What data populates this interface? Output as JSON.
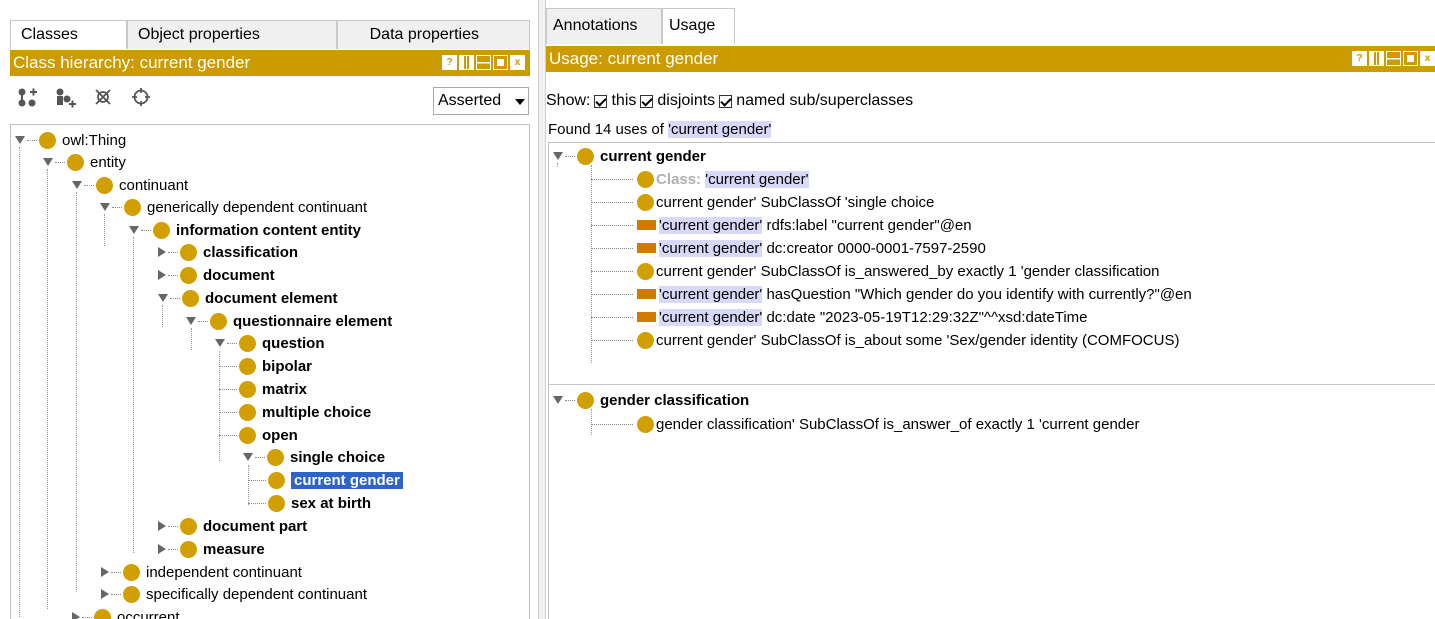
{
  "left": {
    "tabs": [
      "Classes",
      "Object properties",
      "Data properties"
    ],
    "view_title": "Class hierarchy: current gender",
    "view_buttons": [
      "?",
      "",
      "",
      "",
      "x"
    ],
    "tool_icons": [
      "add-subclass-icon",
      "add-sibling-icon",
      "delete-class-icon",
      "target-icon"
    ],
    "select_value": "Asserted",
    "tree": [
      {
        "label": "owl:Thing",
        "bold": false,
        "state": "open"
      },
      {
        "label": "entity",
        "bold": false,
        "state": "open"
      },
      {
        "label": "continuant",
        "bold": false,
        "state": "open"
      },
      {
        "label": "generically dependent continuant",
        "bold": false,
        "state": "open"
      },
      {
        "label": "information content entity",
        "bold": true,
        "state": "open"
      },
      {
        "label": "classification",
        "bold": true,
        "state": "closed"
      },
      {
        "label": "document",
        "bold": true,
        "state": "closed"
      },
      {
        "label": "document element",
        "bold": true,
        "state": "open"
      },
      {
        "label": "questionnaire element",
        "bold": true,
        "state": "open"
      },
      {
        "label": "question",
        "bold": true,
        "state": "open"
      },
      {
        "label": "bipolar",
        "bold": true,
        "state": "leaf"
      },
      {
        "label": "matrix",
        "bold": true,
        "state": "leaf"
      },
      {
        "label": "multiple choice",
        "bold": true,
        "state": "leaf"
      },
      {
        "label": "open",
        "bold": true,
        "state": "leaf"
      },
      {
        "label": "single choice",
        "bold": true,
        "state": "open"
      },
      {
        "label": "current gender",
        "bold": true,
        "state": "leaf",
        "selected": true
      },
      {
        "label": "sex at birth",
        "bold": true,
        "state": "leaf"
      },
      {
        "label": "document part",
        "bold": true,
        "state": "closed"
      },
      {
        "label": "measure",
        "bold": true,
        "state": "closed"
      },
      {
        "label": "independent continuant",
        "bold": false,
        "state": "closed"
      },
      {
        "label": "specifically dependent continuant",
        "bold": false,
        "state": "closed"
      },
      {
        "label": "occurrent",
        "bold": false,
        "state": "closed"
      }
    ]
  },
  "right": {
    "tabs": [
      "Annotations",
      "Usage"
    ],
    "view_title": "Usage: current gender",
    "show_label": "Show:",
    "show_options": [
      "this",
      "disjoints",
      "named sub/superclasses"
    ],
    "found_prefix": "Found 14 uses of ",
    "found_term": "'current gender'",
    "sections": [
      {
        "header": "current gender",
        "rows": [
          {
            "kind": "dot",
            "grey": "Class:",
            "hl": "'current gender'",
            "rest": ""
          },
          {
            "kind": "dot",
            "grey": "",
            "hl": "",
            "rest": "current gender' SubClassOf 'single choice"
          },
          {
            "kind": "rect",
            "grey": "",
            "hl": "'current gender'",
            "rest": " rdfs:label \"current gender\"@en"
          },
          {
            "kind": "rect",
            "grey": "",
            "hl": "'current gender'",
            "rest": " dc:creator 0000-0001-7597-2590"
          },
          {
            "kind": "dot",
            "grey": "",
            "hl": "",
            "rest": "current gender' SubClassOf is_answered_by exactly 1 'gender classification"
          },
          {
            "kind": "rect",
            "grey": "",
            "hl": "'current gender'",
            "rest": " hasQuestion \"Which gender do you identify with currently?\"@en"
          },
          {
            "kind": "rect",
            "grey": "",
            "hl": "'current gender'",
            "rest": " dc:date \"2023-05-19T12:29:32Z\"^^xsd:dateTime"
          },
          {
            "kind": "dot",
            "grey": "",
            "hl": "",
            "rest": "current gender' SubClassOf is_about some 'Sex/gender identity (COMFOCUS)"
          }
        ]
      },
      {
        "header": "gender classification",
        "rows": [
          {
            "kind": "dot",
            "grey": "",
            "hl": "",
            "rest": "gender classification' SubClassOf is_answer_of exactly 1 'current gender"
          }
        ]
      }
    ]
  },
  "colors": {
    "accent": "#cc9b00",
    "class_dot": "#d19f00",
    "annotation_rect": "#d17a00",
    "selection": "#2e64c8",
    "highlight": "#d8d8f8"
  }
}
